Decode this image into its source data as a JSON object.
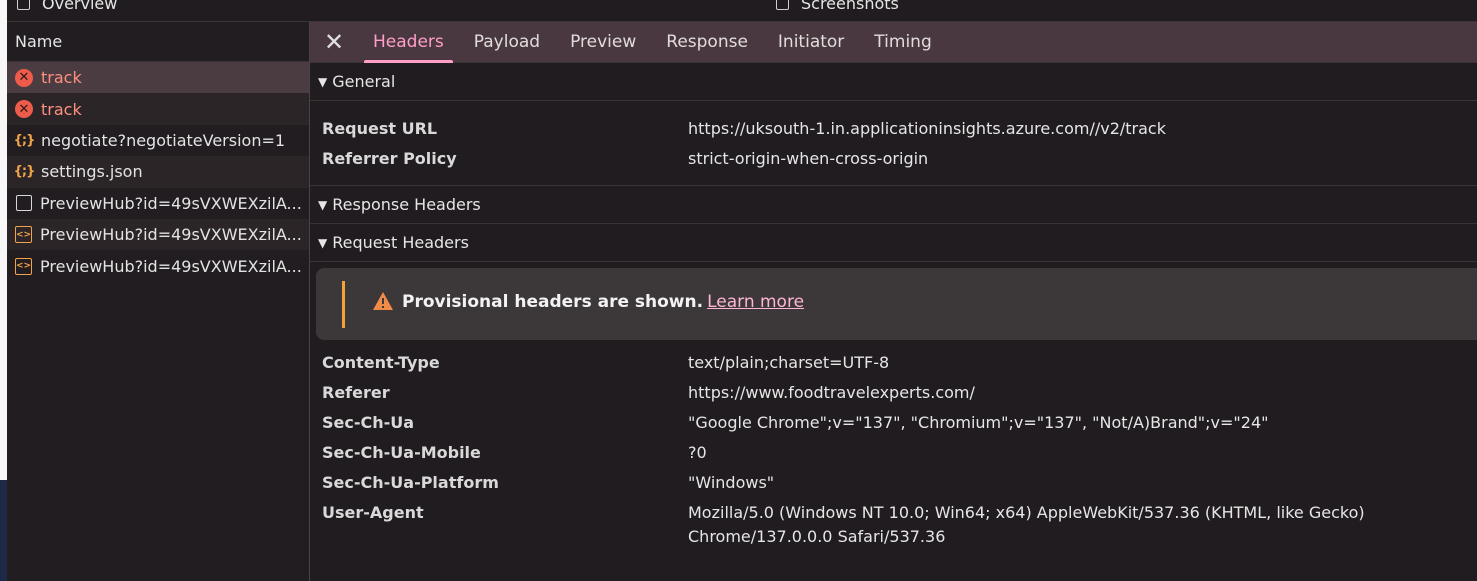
{
  "top_checkboxes": [
    {
      "label": "Overview"
    },
    {
      "label": "Screenshots"
    }
  ],
  "list": {
    "header": "Name",
    "items": [
      {
        "icon": "error-icon",
        "label": "track",
        "type": "error"
      },
      {
        "icon": "error-icon",
        "label": "track",
        "type": "error"
      },
      {
        "icon": "json-icon",
        "label": "negotiate?negotiateVersion=1",
        "type": "json"
      },
      {
        "icon": "json-icon",
        "label": "settings.json",
        "type": "json"
      },
      {
        "icon": "document-icon",
        "label": "PreviewHub?id=49sVXWEXzilA...",
        "type": "doc"
      },
      {
        "icon": "websocket-icon",
        "label": "PreviewHub?id=49sVXWEXzilA...",
        "type": "ws"
      },
      {
        "icon": "websocket-icon",
        "label": "PreviewHub?id=49sVXWEXzilA...",
        "type": "ws"
      }
    ]
  },
  "tabs": [
    "Headers",
    "Payload",
    "Preview",
    "Response",
    "Initiator",
    "Timing"
  ],
  "active_tab": "Headers",
  "general": {
    "title": "General",
    "rows": [
      {
        "key": "Request URL",
        "value": "https://uksouth-1.in.applicationinsights.azure.com//v2/track"
      },
      {
        "key": "Referrer Policy",
        "value": "strict-origin-when-cross-origin"
      }
    ]
  },
  "response_headers": {
    "title": "Response Headers"
  },
  "request_headers": {
    "title": "Request Headers",
    "warning": {
      "bold": "Provisional headers are shown.",
      "link": "Learn more"
    },
    "rows": [
      {
        "key": "Content-Type",
        "value": "text/plain;charset=UTF-8"
      },
      {
        "key": "Referer",
        "value": "https://www.foodtravelexperts.com/"
      },
      {
        "key": "Sec-Ch-Ua",
        "value": "\"Google Chrome\";v=\"137\", \"Chromium\";v=\"137\", \"Not/A)Brand\";v=\"24\""
      },
      {
        "key": "Sec-Ch-Ua-Mobile",
        "value": "?0"
      },
      {
        "key": "Sec-Ch-Ua-Platform",
        "value": "\"Windows\""
      },
      {
        "key": "User-Agent",
        "value": "Mozilla/5.0 (Windows NT 10.0; Win64; x64) AppleWebKit/537.36 (KHTML, like Gecko) Chrome/137.0.0.0 Safari/537.36"
      }
    ]
  },
  "colors": {
    "accent": "#ff9fca",
    "error": "#ee5b4a",
    "warning": "#f2a33a"
  }
}
